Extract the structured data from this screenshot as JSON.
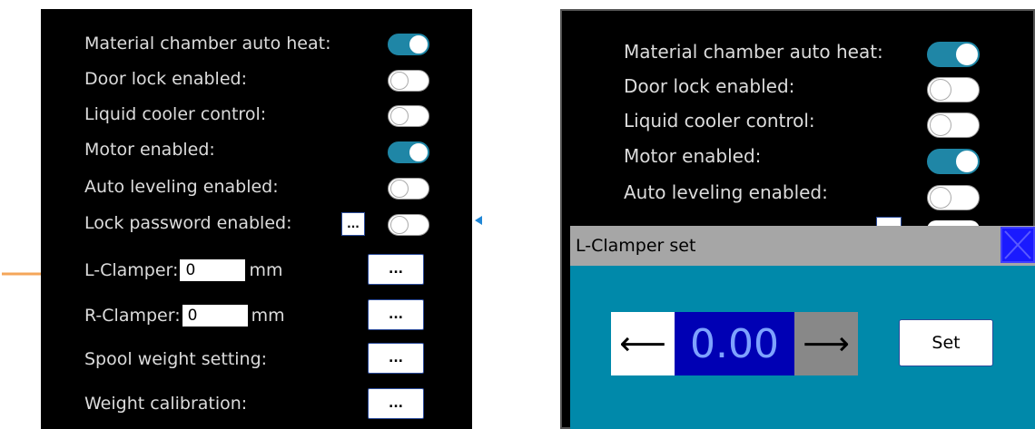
{
  "left_panel": {
    "settings": [
      {
        "label": "Material chamber auto heat:",
        "toggle": true
      },
      {
        "label": "Door lock enabled:",
        "toggle": false
      },
      {
        "label": "Liquid cooler control:",
        "toggle": false
      },
      {
        "label": "Motor enabled:",
        "toggle": true
      },
      {
        "label": "Auto leveling enabled:",
        "toggle": false
      },
      {
        "label": "Lock password enabled:",
        "toggle": false,
        "edit_label": "..."
      }
    ],
    "l_clamper": {
      "label": "L-Clamper:",
      "value": "0",
      "unit": "mm",
      "button_label": "..."
    },
    "r_clamper": {
      "label": "R-Clamper:",
      "value": "0",
      "unit": "mm",
      "button_label": "..."
    },
    "spool_weight": {
      "label": "Spool weight setting:",
      "button_label": "..."
    },
    "weight_calibration": {
      "label": "Weight calibration:",
      "button_label": "..."
    }
  },
  "right_panel": {
    "settings": [
      {
        "label": "Material chamber auto heat:",
        "toggle": true
      },
      {
        "label": "Door lock enabled:",
        "toggle": false
      },
      {
        "label": "Liquid cooler control:",
        "toggle": false
      },
      {
        "label": "Motor enabled:",
        "toggle": true
      },
      {
        "label": "Auto leveling enabled:",
        "toggle": false
      }
    ]
  },
  "dialog": {
    "title": "L-Clamper set",
    "decrement_symbol": "⟵",
    "value": "0.00",
    "increment_symbol": "⟶",
    "set_label": "Set"
  },
  "colors": {
    "toggle_on": "#1f86a6",
    "dialog_body": "#0089aa",
    "value_box": "#0000b4",
    "close_button": "#1a1aff",
    "annotation_arrow": "#f4a65a"
  }
}
